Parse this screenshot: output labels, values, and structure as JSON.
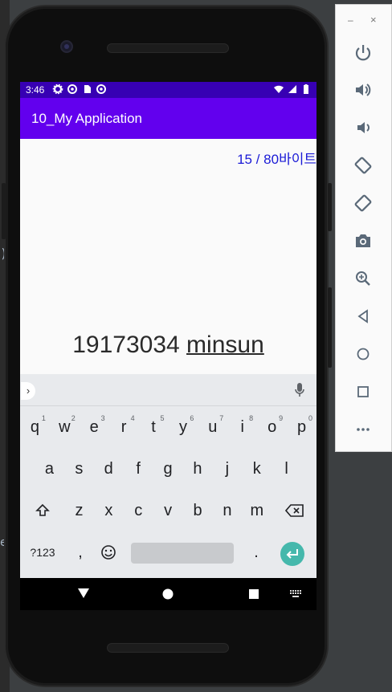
{
  "status_bar": {
    "time": "3:46"
  },
  "app_bar": {
    "title": "10_My Application"
  },
  "content": {
    "byte_counter": "15 / 80바이트",
    "typed_number": "19173034",
    "typed_word": "minsun"
  },
  "keyboard": {
    "row1": [
      {
        "key": "q",
        "hint": "1"
      },
      {
        "key": "w",
        "hint": "2"
      },
      {
        "key": "e",
        "hint": "3"
      },
      {
        "key": "r",
        "hint": "4"
      },
      {
        "key": "t",
        "hint": "5"
      },
      {
        "key": "y",
        "hint": "6"
      },
      {
        "key": "u",
        "hint": "7"
      },
      {
        "key": "i",
        "hint": "8"
      },
      {
        "key": "o",
        "hint": "9"
      },
      {
        "key": "p",
        "hint": "0"
      }
    ],
    "row2": [
      "a",
      "s",
      "d",
      "f",
      "g",
      "h",
      "j",
      "k",
      "l"
    ],
    "row3": [
      "z",
      "x",
      "c",
      "v",
      "b",
      "n",
      "m"
    ],
    "symbols_label": "?123",
    "comma": ",",
    "period": "."
  },
  "side_panel": {
    "minimize": "–",
    "close": "×",
    "tools": [
      "power-icon",
      "volume-up-icon",
      "volume-down-icon",
      "rotate-left-icon",
      "rotate-right-icon",
      "camera-icon",
      "zoom-icon",
      "back-icon",
      "home-icon",
      "overview-icon",
      "more-icon"
    ]
  },
  "colors": {
    "status_bar": "#3700b3",
    "app_bar": "#6200ee",
    "byte_counter": "#1a1ad6",
    "enter_key": "#45b8ac"
  }
}
